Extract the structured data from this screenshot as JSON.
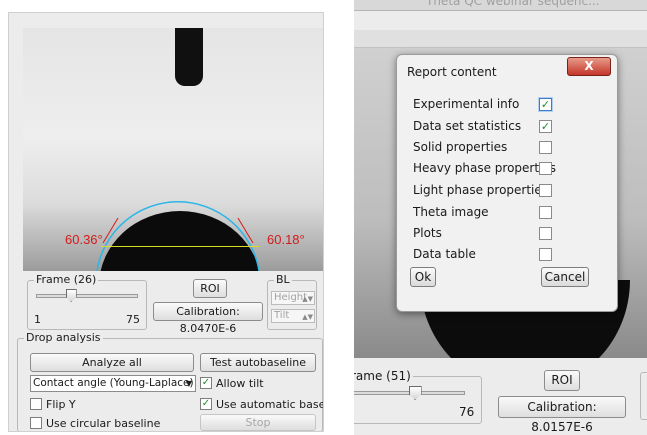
{
  "left": {
    "angles": {
      "left": "60.36°",
      "right": "60.18°"
    },
    "frame": {
      "legend": "Frame (26)",
      "min": "1",
      "max": "75",
      "position": 0.34
    },
    "roi_label": "ROI",
    "calibration_label": "Calibration: 8.0470E-6",
    "bl": {
      "legend": "BL",
      "height_label": "Height",
      "tilt_label": "Tilt"
    },
    "drop_analysis": {
      "legend": "Drop analysis",
      "analyze_all": "Analyze all",
      "test_autobaseline": "Test autobaseline",
      "method_selected": "Contact angle (Young-Laplace)",
      "allow_tilt": {
        "label": "Allow tilt",
        "checked": true
      },
      "flip_y": {
        "label": "Flip Y",
        "checked": false
      },
      "use_automatic_baseline": {
        "label": "Use automatic baseline",
        "checked": true
      },
      "use_circular_baseline": {
        "label": "Use circular baseline",
        "checked": false
      },
      "stop": "Stop"
    }
  },
  "right": {
    "window_title": "Theta QC webinar sequenc...",
    "dialog": {
      "title": "Report content",
      "close_label": "X",
      "items": [
        {
          "label": "Experimental info",
          "checked": true
        },
        {
          "label": "Data set statistics",
          "checked": true
        },
        {
          "label": "Solid properties",
          "checked": false
        },
        {
          "label": "Heavy phase properties",
          "checked": false
        },
        {
          "label": "Light phase properties",
          "checked": false
        },
        {
          "label": "Theta image",
          "checked": false
        },
        {
          "label": "Plots",
          "checked": false
        },
        {
          "label": "Data table",
          "checked": false
        }
      ],
      "ok_label": "Ok",
      "cancel_label": "Cancel"
    },
    "frame": {
      "legend": "rame (51)",
      "max": "76",
      "position": 0.55
    },
    "roi_label": "ROI",
    "calibration_label": "Calibration: 8.0157E-6"
  },
  "colors": {
    "angle_text": "#d41a1a",
    "baseline": "#d8e020",
    "check": "#1d8a2e",
    "close_button": "#c3362a"
  }
}
